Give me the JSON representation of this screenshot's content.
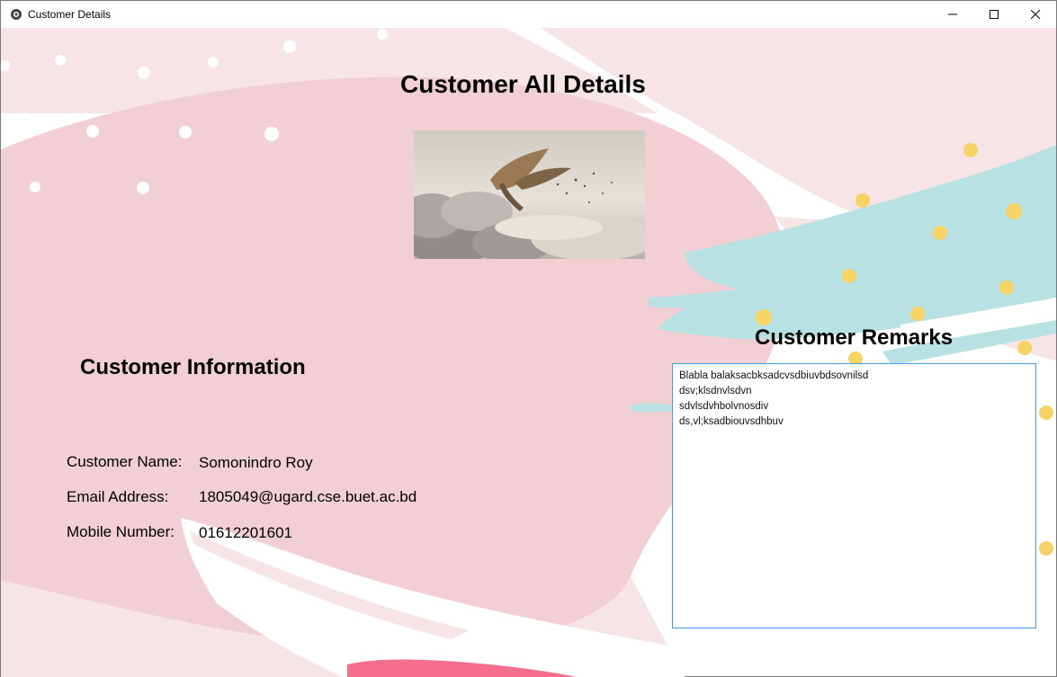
{
  "window": {
    "title": "Customer Details",
    "controls": {
      "minimize": "minimize",
      "maximize": "maximize",
      "close": "close"
    }
  },
  "page": {
    "heading": "Customer All Details",
    "photo_icon": "flying-person-clouds-image"
  },
  "info": {
    "heading": "Customer Information",
    "fields": [
      {
        "label": "Customer Name:",
        "value": "Somonindro Roy"
      },
      {
        "label": "Email Address:",
        "value": "1805049@ugard.cse.buet.ac.bd"
      },
      {
        "label": "Mobile Number:",
        "value": "01612201601"
      }
    ]
  },
  "remarks": {
    "heading": "Customer Remarks",
    "lines": [
      "Blabla balaksacbksadcvsdbiuvbdsovnilsd",
      "dsv;klsdnvlsdvn",
      "sdvlsdvhbolvnosdiv",
      "ds,vl;ksadbiouvsdhbuv"
    ]
  },
  "colors": {
    "pink_blob": "#f2cfd4",
    "light_pink": "#f7e4e6",
    "teal": "#b8e1e3",
    "yellow_dot": "#f6d363",
    "accent_border": "#3d9be9"
  }
}
